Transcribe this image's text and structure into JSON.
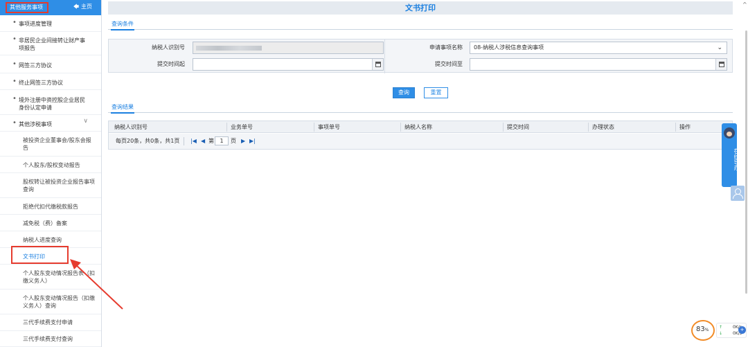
{
  "sidebar": {
    "title": "其他服务事项",
    "home_label": "主页",
    "items": [
      {
        "label": "事项进度管理"
      },
      {
        "label": "非居民企业间接转让财产事项报告"
      },
      {
        "label": "网签三方协议"
      },
      {
        "label": "终止网签三方协议"
      },
      {
        "label": "境外注册中资控股企业居民身份认定申请"
      },
      {
        "label": "其他涉税事项"
      }
    ],
    "subitems": [
      {
        "label": "被投资企业董事会/股东会报告"
      },
      {
        "label": "个人股东/股权变动报告"
      },
      {
        "label": "股权转让被投资企业报告事项查询"
      },
      {
        "label": "拒绝代扣代缴税款报告"
      },
      {
        "label": "减免税（费）备案"
      },
      {
        "label": "纳税人进度查询"
      },
      {
        "label": "文书打印"
      },
      {
        "label": "个人股东变动情况报告表（扣缴义务人）"
      },
      {
        "label": "个人股东变动情况报告（扣缴义务人）查询"
      },
      {
        "label": "三代手续费支付申请"
      },
      {
        "label": "三代手续费支付查询"
      }
    ]
  },
  "page": {
    "title": "文书打印",
    "query_tab": "查询条件",
    "result_tab": "查询结果"
  },
  "form": {
    "taxpayer_id_label": "纳税人识别号",
    "item_name_label": "申请事项名称",
    "item_name_value": "08-纳税人涉税信息查询事项",
    "submit_from_label": "提交时间起",
    "submit_to_label": "提交时间至",
    "query_button": "查询",
    "reset_button": "重置"
  },
  "table": {
    "columns": [
      "纳税人识别号",
      "业务单号",
      "事项单号",
      "纳税人名称",
      "提交时间",
      "办理状态",
      "操作"
    ],
    "pager_summary": "每页20条，共0条，共1页",
    "page_prefix": "第",
    "page_value": "1",
    "page_suffix": "页"
  },
  "widgets": {
    "help_label": "在线导办",
    "speed_percent": "83",
    "speed_percent_unit": "%",
    "upload_speed": "0K/s",
    "download_speed": "0K/s"
  }
}
